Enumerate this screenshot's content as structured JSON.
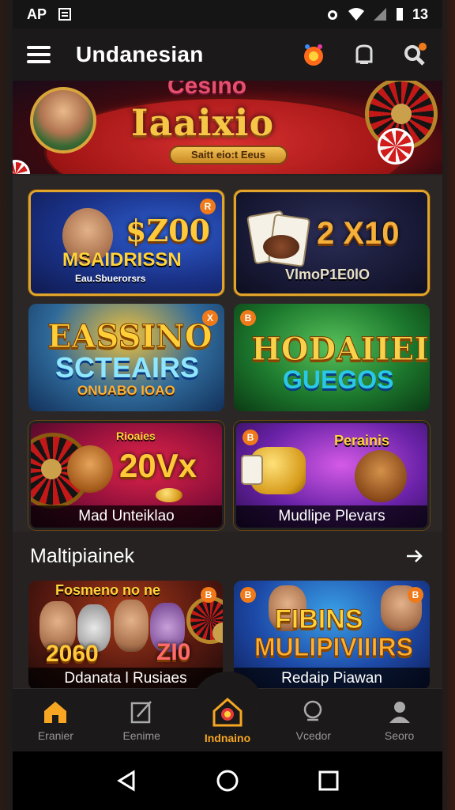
{
  "status_bar": {
    "carrier": "AP",
    "time": "13"
  },
  "app_bar": {
    "title": "Undanesian"
  },
  "hero": {
    "top_word": "Cesino",
    "title": "Iaaixio",
    "subtitle": "Saitt eio:t Eeus"
  },
  "games": [
    {
      "amount": "$Z00",
      "line1": "MSAIDRISSN",
      "line2": "Eau.Sbuerorsrs",
      "badge": "R"
    },
    {
      "amount": "2 X10",
      "line1": "VlmoP1E0lO",
      "badge": ""
    },
    {
      "line1": "EASSINO",
      "line2": "SCTEAIRS",
      "line3": "ONUABO IOAO",
      "badge": "X"
    },
    {
      "line1": "HODAIIEI",
      "line2": "GUEGOS",
      "badge": "B"
    },
    {
      "amount": "20Vx",
      "top": "Rioaies",
      "caption": "Mad Unteiklao"
    },
    {
      "top": "Perainis",
      "caption": "Mudlipe Plevars",
      "badge": "B"
    }
  ],
  "section": {
    "title": "Maltipiainek"
  },
  "row2": [
    {
      "top": "Fosmeno no ne",
      "amount": "2060",
      "amount2": "ZI0",
      "caption": "Ddanata l Rusiaes",
      "badge": "B"
    },
    {
      "line1": "FIBINS",
      "line2": "MULIPIVIIIRS",
      "caption": "Redaip Piawan",
      "badge": "B"
    }
  ],
  "bottom_nav": [
    {
      "label": "Eranier",
      "icon": "home-icon",
      "active": false
    },
    {
      "label": "Eenime",
      "icon": "edit-icon",
      "active": false
    },
    {
      "label": "Indnaino",
      "icon": "casino-home-icon",
      "active": true
    },
    {
      "label": "Vcedor",
      "icon": "search-icon",
      "active": false
    },
    {
      "label": "Seoro",
      "icon": "profile-icon",
      "active": false
    }
  ],
  "colors": {
    "accent": "#f6a623",
    "tile_border": "#e0a52a",
    "background": "#262222"
  }
}
